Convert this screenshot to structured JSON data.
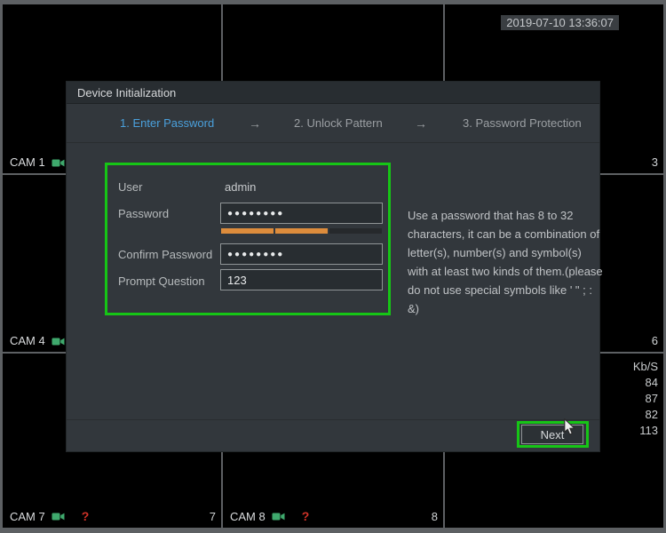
{
  "colors": {
    "highlight_green": "#16c516",
    "step_active_blue": "#4aa0dc",
    "strength_filled_orange": "#dd8c3c",
    "camera_icon_green": "#3fa96d",
    "warning_red": "#d03227"
  },
  "grid": {
    "timestamp": "2019-07-10 13:36:07",
    "camera_labels": {
      "cam1": "CAM 1",
      "cam4": "CAM 4",
      "cam7": "CAM 7",
      "cam8": "CAM 8"
    },
    "channel_numbers": {
      "ch3": "3",
      "ch6": "6",
      "ch7": "7",
      "ch8": "8"
    },
    "warning_glyph": "?",
    "bitrate_panel": {
      "header": "Kb/S",
      "values": [
        "84",
        "87",
        "82",
        "113"
      ]
    }
  },
  "dialog": {
    "title": "Device Initialization",
    "steps": [
      {
        "label": "1.  Enter Password",
        "active": true
      },
      {
        "label": "2.  Unlock Pattern",
        "active": false
      },
      {
        "label": "3.  Password Protection",
        "active": false
      }
    ],
    "step_arrow": "→",
    "form": {
      "user_label": "User",
      "user_value": "admin",
      "password_label": "Password",
      "password_masked": "●●●●●●●●",
      "confirm_label": "Confirm Password",
      "confirm_masked": "●●●●●●●●",
      "prompt_label": "Prompt Question",
      "prompt_value": "123",
      "password_strength": {
        "segments_total": 3,
        "segments_filled": 2
      }
    },
    "hint": "Use a password that has 8 to 32\ncharacters, it can be a combination of\nletter(s), number(s) and symbol(s)\nwith at least two kinds of them.(please\ndo not use special symbols like ' \" ; : &)",
    "next_button": "Next"
  }
}
